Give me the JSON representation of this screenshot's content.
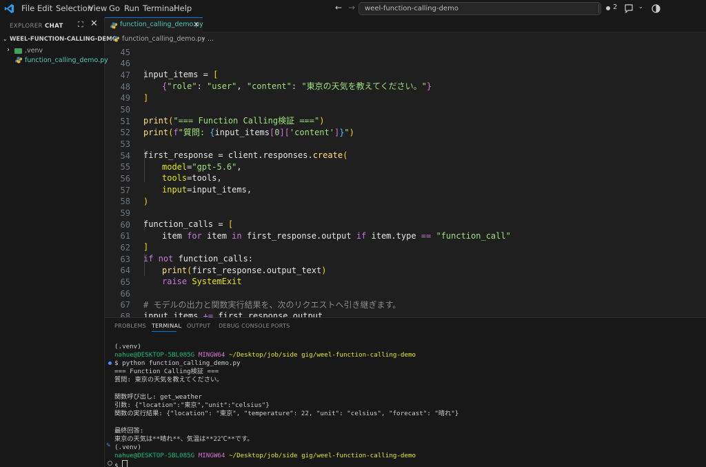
{
  "titlebar": {
    "menu": [
      "File",
      "Edit",
      "Selection",
      "View",
      "Go",
      "Run",
      "Terminal",
      "Help"
    ],
    "search": "weel-function-calling-demo",
    "badge_count": "2"
  },
  "sidebar": {
    "tab_explorer": "EXPLORER",
    "tab_chat": "CHAT",
    "root": "WEEL-FUNCTION-CALLING-DEMO",
    "items": [
      ".venv",
      "function_calling_demo.py"
    ]
  },
  "editor": {
    "tab": "function_calling_demo.py",
    "breadcrumb_file": "function_calling_demo.py",
    "breadcrumb_more": "...",
    "line_numbers": [
      "45",
      "46",
      "47",
      "48",
      "49",
      "50",
      "51",
      "52",
      "53",
      "54",
      "55",
      "56",
      "57",
      "58",
      "59",
      "60",
      "61",
      "62",
      "63",
      "64",
      "65",
      "66",
      "67",
      "68"
    ],
    "lines": {
      "l46": [
        "input_items",
        " = ",
        "["
      ],
      "l47": [
        "{",
        "\"role\"",
        ": ",
        "\"user\"",
        ", ",
        "\"content\"",
        ": ",
        "\"東京の天気を教えてください。\"",
        "}"
      ],
      "l48": [
        "]"
      ],
      "l50": [
        "print",
        "(",
        "\"=== Function Calling検証 ===\"",
        ")"
      ],
      "l51": [
        "print",
        "(",
        "f",
        "\"質問: ",
        "{",
        "input_items",
        "[",
        "0",
        "][",
        "'content'",
        "]",
        "}",
        "\"",
        ")"
      ],
      "l53": [
        "first_response",
        " = ",
        "client",
        ".",
        "responses",
        ".",
        "create",
        "("
      ],
      "l54": [
        "model",
        "=",
        "\"gpt-5.6\"",
        ","
      ],
      "l55": [
        "tools",
        "=",
        "tools",
        ","
      ],
      "l56": [
        "input",
        "=",
        "input_items",
        ","
      ],
      "l57": [
        ")"
      ],
      "l59": [
        "function_calls",
        " = ",
        "["
      ],
      "l60": [
        "item",
        " for ",
        "item",
        " in ",
        "first_response",
        ".",
        "output",
        " if ",
        "item",
        ".",
        "type",
        " == ",
        "\"function_call\""
      ],
      "l61": [
        "]"
      ],
      "l62": [
        "if",
        " not ",
        "function_calls",
        ":"
      ],
      "l63": [
        "print",
        "(",
        "first_response",
        ".",
        "output_text",
        ")"
      ],
      "l64": [
        "raise",
        " ",
        "SystemExit"
      ],
      "l66": [
        "# モデルの出力と関数実行結果を、次のリクエストへ引き継ぎます。"
      ],
      "l67": [
        "input_items",
        " += ",
        "first_response",
        ".",
        "output"
      ]
    }
  },
  "panel": {
    "tabs": [
      "PROBLEMS",
      "TERMINAL",
      "OUTPUT",
      "DEBUG CONSOLE",
      "PORTS"
    ],
    "active_tab": "TERMINAL",
    "terminal": {
      "venv1": "(.venv)",
      "user": "nahue@DESKTOP-5BL085G",
      "shell": "MINGW64",
      "path": "~/Desktop/job/side gig/weel-function-calling-demo",
      "cmd": "$ python function_calling_demo.py",
      "out1": "=== Function Calling検証 ===",
      "out2": "質問: 東京の天気を教えてください。",
      "out3": "関数呼び出し: get_weather",
      "out4": "引数: {\"location\":\"東京\",\"unit\":\"celsius\"}",
      "out5": "関数の実行結果: {\"location\": \"東京\", \"temperature\": 22, \"unit\": \"celsius\", \"forecast\": \"晴れ\"}",
      "out6": "最終回答:",
      "out7": "東京の天気は**晴れ**、気温は**22℃**です。",
      "venv2": "(.venv)",
      "prompt": "$ "
    }
  },
  "colors": {
    "accent": "#0078d4",
    "background": "#1f1f1f",
    "sidebar": "#181818"
  }
}
